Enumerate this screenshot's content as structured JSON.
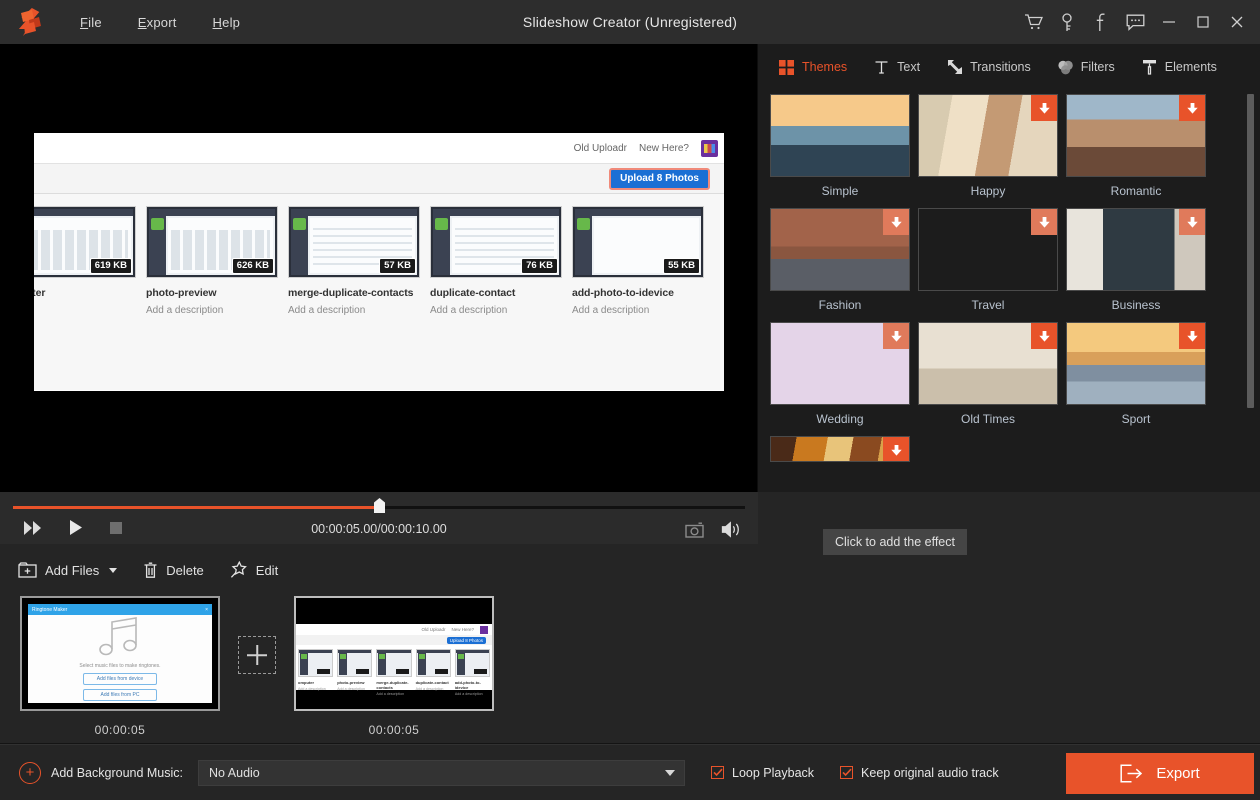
{
  "window": {
    "title": "Slideshow Creator (Unregistered)",
    "menu": [
      {
        "label": "File",
        "mnemonic": "F"
      },
      {
        "label": "Export",
        "mnemonic": "E"
      },
      {
        "label": "Help",
        "mnemonic": "H"
      }
    ],
    "controls": [
      {
        "name": "cart-icon",
        "tooltip": "Buy"
      },
      {
        "name": "key-icon",
        "tooltip": "Register"
      },
      {
        "name": "facebook-icon",
        "tooltip": "Facebook"
      },
      {
        "name": "feedback-icon",
        "tooltip": "Feedback"
      },
      {
        "name": "minimize-icon",
        "tooltip": "Minimize"
      },
      {
        "name": "maximize-icon",
        "tooltip": "Maximize"
      },
      {
        "name": "close-icon",
        "tooltip": "Close"
      }
    ]
  },
  "colors": {
    "accent": "#e8532a",
    "panel_bg": "#252525",
    "titlebar_bg": "#2d2d2d",
    "right_panel_bg": "#1c1c1c",
    "preview_bg": "#000000",
    "label_text": "#b9c3cf"
  },
  "preview": {
    "flickr_links": [
      "Old Uploadr",
      "New Here?"
    ],
    "upload_button": "Upload 8 Photos",
    "photos": [
      {
        "name": "omputer",
        "description": "Add a description",
        "size": "619 KB"
      },
      {
        "name": "photo-preview",
        "description": "Add a description",
        "size": "626 KB"
      },
      {
        "name": "merge-duplicate-contacts",
        "description": "Add a description",
        "size": "57 KB"
      },
      {
        "name": "duplicate-contact",
        "description": "Add a description",
        "size": "76 KB"
      },
      {
        "name": "add-photo-to-idevice",
        "description": "Add a description",
        "size": "55 KB"
      }
    ]
  },
  "transport": {
    "timecode": "00:00:05.00/00:00:10.00",
    "current": "00:00:05.00",
    "total": "00:00:10.00",
    "progress_percent": 50,
    "buttons": [
      {
        "name": "fast-forward-icon",
        "label": "Next Frame"
      },
      {
        "name": "play-icon",
        "label": "Play"
      },
      {
        "name": "stop-icon",
        "label": "Stop"
      }
    ],
    "right_buttons": [
      {
        "name": "snapshot-camera-icon",
        "label": "Snapshot"
      },
      {
        "name": "volume-icon",
        "label": "Volume"
      }
    ]
  },
  "right_panel": {
    "tabs": [
      {
        "label": "Themes",
        "icon": "grid-icon",
        "active": true
      },
      {
        "label": "Text",
        "icon": "text-t-icon",
        "active": false
      },
      {
        "label": "Transitions",
        "icon": "transitions-arrows-icon",
        "active": false
      },
      {
        "label": "Filters",
        "icon": "filters-circles-icon",
        "active": false
      },
      {
        "label": "Elements",
        "icon": "paint-roller-icon",
        "active": false
      }
    ],
    "themes": [
      {
        "label": "Simple",
        "downloadable": false,
        "thumb": "photographer-sunset"
      },
      {
        "label": "Happy",
        "downloadable": true,
        "thumb": "two-women-laughing"
      },
      {
        "label": "Romantic",
        "downloadable": true,
        "thumb": "woman-canyon"
      },
      {
        "label": "Fashion",
        "downloadable": true,
        "thumb": "living-room-sofa"
      },
      {
        "label": "Travel",
        "downloadable": true,
        "thumb": "man-arms-open-mountain"
      },
      {
        "label": "Business",
        "downloadable": true,
        "thumb": "office-sticky-notes"
      },
      {
        "label": "Wedding",
        "downloadable": true,
        "thumb": "hands-heart-bride"
      },
      {
        "label": "Old Times",
        "downloadable": true,
        "thumb": "vintage-bicycle"
      },
      {
        "label": "Sport",
        "downloadable": true,
        "thumb": "skateboarder"
      },
      {
        "label": "",
        "downloadable": true,
        "thumb": "partial-warm-scene"
      }
    ],
    "scrollbar": {
      "position_percent": 0,
      "thumb_fraction": 0.8
    }
  },
  "toolbar": {
    "add_files": "Add Files",
    "delete": "Delete",
    "edit": "Edit"
  },
  "storyboard": {
    "effect_hint": "Click to add the effect",
    "slides": [
      {
        "duration": "00:00:05",
        "selected": false,
        "content": {
          "title": "Ringtone Maker",
          "caption": "Select music files to make ringtones.",
          "buttons": [
            "Add files from device",
            "Add files from PC"
          ]
        }
      },
      {
        "duration": "00:00:05",
        "selected": true,
        "content": {
          "links": [
            "Old Uploadr",
            "New Here?"
          ],
          "upload_button": "Upload 8 Photos",
          "photos": [
            {
              "name": "omputer",
              "description": "Add a description"
            },
            {
              "name": "photo-preview",
              "description": "Add a description"
            },
            {
              "name": "merge-duplicate-contacts",
              "description": "Add a description"
            },
            {
              "name": "duplicate-contact",
              "description": "Add a description"
            },
            {
              "name": "add-photo-to-idevice",
              "description": "Add a description"
            }
          ]
        }
      }
    ],
    "transition_slot": "empty"
  },
  "bottom": {
    "add_music_label": "Add Background Music:",
    "audio_value": "No Audio",
    "audio_options": [
      "No Audio"
    ],
    "loop_playback": {
      "label": "Loop Playback",
      "checked": true
    },
    "keep_audio": {
      "label": "Keep original audio track",
      "checked": true
    },
    "export_label": "Export"
  }
}
